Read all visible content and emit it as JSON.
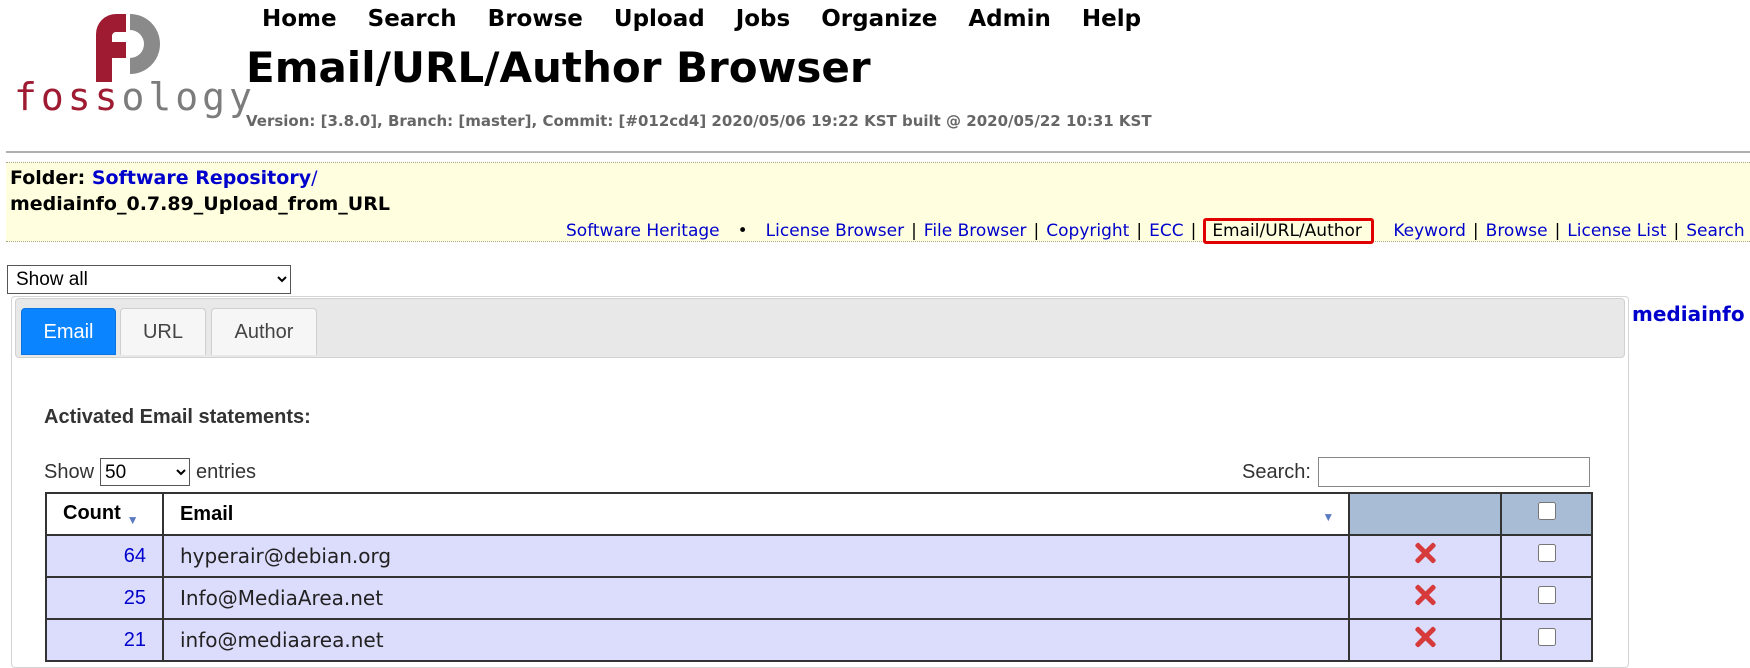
{
  "header": {
    "logo_text_part1": "foss",
    "logo_text_part2": "ology",
    "menu": [
      "Home",
      "Search",
      "Browse",
      "Upload",
      "Jobs",
      "Organize",
      "Admin",
      "Help"
    ],
    "page_title": "Email/URL/Author Browser",
    "version_info": "Version: [3.8.0], Branch: [master], Commit: [#012cd4] 2020/05/06 19:22 KST built @ 2020/05/22 10:31 KST"
  },
  "folder": {
    "label": "Folder",
    "repository_link": "Software Repository",
    "upload_name": "mediainfo_0.7.89_Upload_from_URL"
  },
  "agent_links": {
    "software_heritage": "Software Heritage",
    "items": [
      "License Browser",
      "File Browser",
      "Copyright",
      "ECC",
      "Email/URL/Author",
      "Keyword",
      "Browse",
      "License List",
      "Search"
    ],
    "current": "Email/URL/Author"
  },
  "filter": {
    "selected": "Show all"
  },
  "tabs": [
    {
      "label": "Email",
      "active": true
    },
    {
      "label": "URL",
      "active": false
    },
    {
      "label": "Author",
      "active": false
    }
  ],
  "section_heading": "Activated Email statements:",
  "entries": {
    "show_label": "Show",
    "selected": "50",
    "entries_label": "entries"
  },
  "search": {
    "label": "Search:",
    "value": ""
  },
  "table": {
    "columns": [
      "Count",
      "Email"
    ],
    "rows": [
      {
        "count": "64",
        "email": "hyperair@debian.org"
      },
      {
        "count": "25",
        "email": "Info@MediaArea.net"
      },
      {
        "count": "21",
        "email": "info@mediaarea.net"
      }
    ]
  },
  "side_link": "mediainfo",
  "colors": {
    "accent_blue": "#0a84ff",
    "link_blue": "#0000cc",
    "highlight_red": "#e00000",
    "folder_bar_bg": "#ffffe0",
    "row_bg": "#dcdcfc",
    "header_cell_bg": "#a9bcd6",
    "logo_red": "#9e1b32"
  },
  "icons": {
    "delete": "x-icon",
    "logo": "fossology-logo-icon",
    "sort": "sort-down-icon"
  }
}
